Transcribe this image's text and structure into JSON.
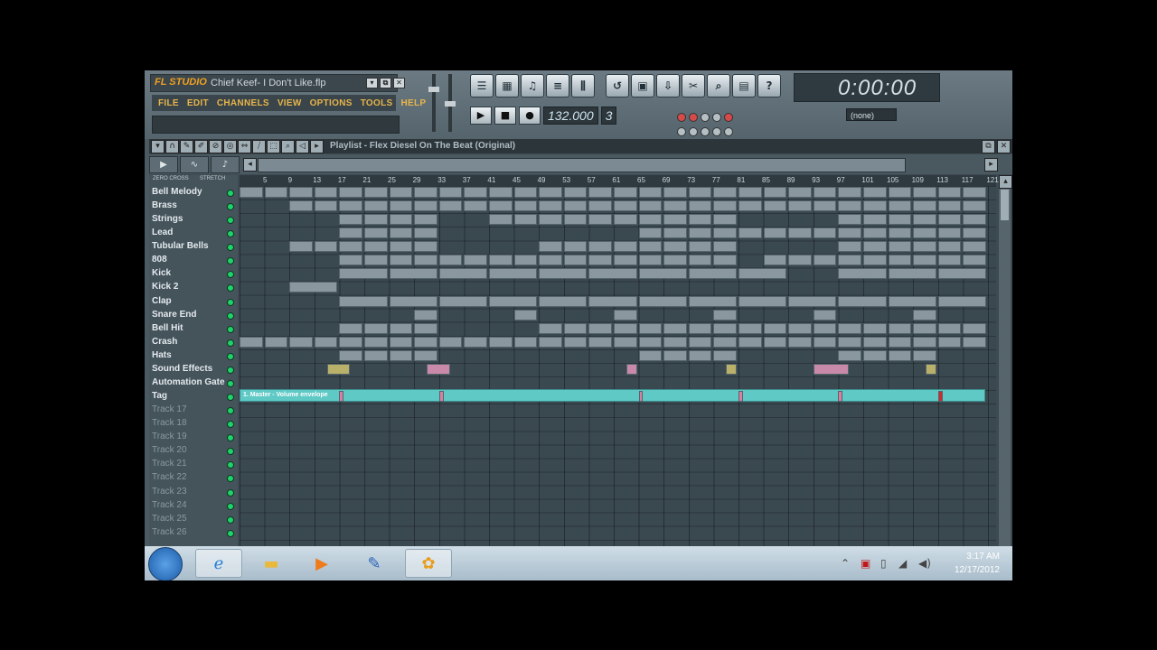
{
  "app": {
    "logo": "FL STUDIO",
    "project_title": "Chief Keef- I Don't Like.flp",
    "window_controls": [
      "▾",
      "⧉",
      "✕"
    ]
  },
  "menu": [
    "FILE",
    "EDIT",
    "CHANNELS",
    "VIEW",
    "OPTIONS",
    "TOOLS",
    "HELP"
  ],
  "toolbar": {
    "clock": "0:00:00",
    "tempo": "132.000",
    "pattern_number": "3",
    "pattern_select": "(none)"
  },
  "playlist": {
    "title": "Playlist - Flex Diesel On The Beat (Original)",
    "zero_cross_label": "ZERO CROSS",
    "stretch_label": "STRETCH",
    "ruler_ticks": [
      "5",
      "9",
      "13",
      "17",
      "21",
      "25",
      "29",
      "33",
      "37",
      "41",
      "45",
      "49",
      "53",
      "57",
      "61",
      "65",
      "69",
      "73",
      "77",
      "81",
      "85",
      "89",
      "93",
      "97",
      "101",
      "105",
      "109",
      "113",
      "117",
      "121"
    ],
    "automation_clip_label": "1. Master - Volume envelope",
    "tracks": [
      {
        "name": "Bell Melody",
        "dim": false
      },
      {
        "name": "Brass",
        "dim": false
      },
      {
        "name": "Strings",
        "dim": false
      },
      {
        "name": "Lead",
        "dim": false
      },
      {
        "name": "Tubular Bells",
        "dim": false
      },
      {
        "name": "808",
        "dim": false
      },
      {
        "name": "Kick",
        "dim": false
      },
      {
        "name": "Kick 2",
        "dim": false
      },
      {
        "name": "Clap",
        "dim": false
      },
      {
        "name": "Snare End",
        "dim": false
      },
      {
        "name": "Bell Hit",
        "dim": false
      },
      {
        "name": "Crash",
        "dim": false
      },
      {
        "name": "Hats",
        "dim": false
      },
      {
        "name": "Sound Effects",
        "dim": false
      },
      {
        "name": "Automation Gate",
        "dim": false
      },
      {
        "name": "Tag",
        "dim": false
      },
      {
        "name": "Track 17",
        "dim": true
      },
      {
        "name": "Track 18",
        "dim": true
      },
      {
        "name": "Track 19",
        "dim": true
      },
      {
        "name": "Track 20",
        "dim": true
      },
      {
        "name": "Track 21",
        "dim": true
      },
      {
        "name": "Track 22",
        "dim": true
      },
      {
        "name": "Track 23",
        "dim": true
      },
      {
        "name": "Track 24",
        "dim": true
      },
      {
        "name": "Track 25",
        "dim": true
      },
      {
        "name": "Track 26",
        "dim": true
      }
    ]
  },
  "taskbar": {
    "items": [
      "start",
      "internet-explorer",
      "file-explorer",
      "media-player",
      "app-4",
      "fl-studio"
    ],
    "time": "3:17 AM",
    "date": "12/17/2012"
  },
  "colors": {
    "menu_text": "#e7b44a",
    "track_led": "#1fd36a",
    "automation_clip": "#5fc9c6",
    "tag_clip": "#d97fa0"
  }
}
